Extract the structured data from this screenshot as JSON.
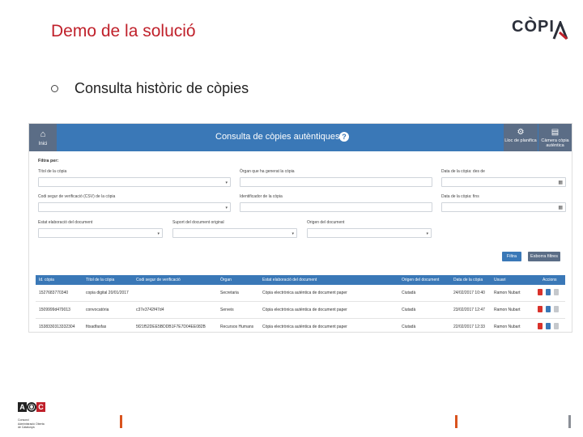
{
  "slide": {
    "title": "Demo de la solució",
    "logo_text": "CÒPI",
    "bullet": "Consulta històric de còpies"
  },
  "colors": {
    "title": "#c0212b",
    "header_blue": "#3a78b7",
    "header_slate": "#5b6d86",
    "pdf_red": "#d9322b",
    "bar_orange": "#d9531e",
    "bar_gray": "#8a8f96"
  },
  "app": {
    "home_icon": "home-icon",
    "home_label": "Inici",
    "title": "Consulta de còpies autèntiques",
    "help_glyph": "?",
    "config_label": "Lloc de planifica",
    "camera_label": "Càmera còpia autèntica",
    "filters_label": "Filtra per:",
    "fields": {
      "title_label": "Títol de la còpia",
      "organ_label": "Òrgan que ha generat la còpia",
      "date_from_label": "Data de la còpia: des de",
      "csv_label": "Codi segur de verificació (CSV) de la còpia",
      "identifier_label": "Identificador de la còpia",
      "date_to_label": "Data de la còpia: fins",
      "state_label": "Estat elaboració del document",
      "support_label": "Suport del document original",
      "origin_label": "Origen del document"
    },
    "filter_button": "Filtra",
    "clear_button": "Esborra filtres",
    "table": {
      "headers": [
        "Id. còpia",
        "Títol de la còpia",
        "Codi segur de verificació",
        "Òrgan",
        "Estat elaboració del document",
        "Origen del document",
        "Data de la còpia",
        "Usuari",
        "Accions"
      ],
      "rows": [
        [
          "1527683770340",
          "copia digital 20/01/2017",
          "",
          "Secretaria",
          "Còpia electrònica autèntica de document paper",
          "Ciutadà",
          "24/02/2017 10:40",
          "Ramon Nubart"
        ],
        [
          "1509999d479013",
          "convocatòria",
          "c37e3742f47d4",
          "Serveis",
          "Còpia electrònica autèntica de document paper",
          "Ciutadà",
          "23/02/2017 12:47",
          "Ramon Nubart"
        ],
        [
          "1538330313332304",
          "fitxadfasfas",
          "5f21f52DEE5BDDB1F7E7D04EE082B",
          "Recursos Humans",
          "Còpia electrònica autèntica de document paper",
          "Ciutadà",
          "22/02/2017 12:33",
          "Ramon Nubart"
        ]
      ]
    }
  },
  "footer": {
    "aoc_letters": [
      "A",
      "O",
      "C"
    ],
    "aoc_sub1": "Consorci",
    "aoc_sub2": "Administració Oberta",
    "aoc_sub3": "de Catalunya"
  }
}
